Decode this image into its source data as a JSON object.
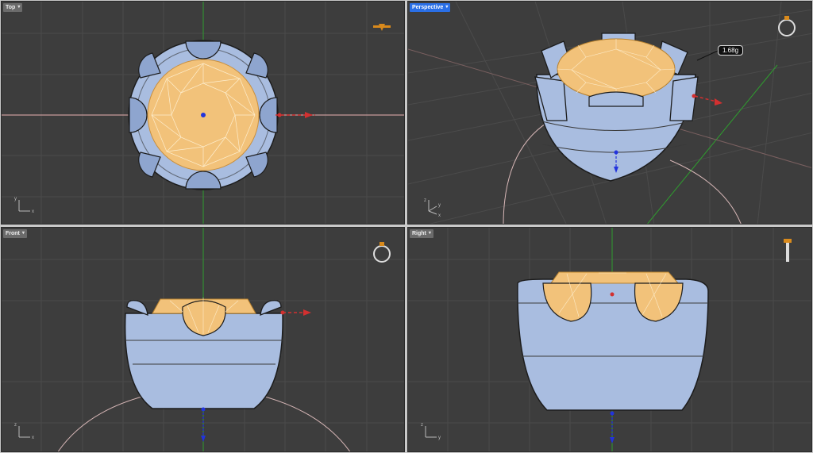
{
  "viewports": {
    "top": {
      "label": "Top"
    },
    "perspective": {
      "label": "Perspective"
    },
    "front": {
      "label": "Front"
    },
    "right": {
      "label": "Right"
    }
  },
  "dropdown_caret": "▾",
  "weight_readout": "1.68g",
  "axes": {
    "x": "x",
    "y": "y",
    "z": "z"
  },
  "colors": {
    "viewport_bg": "#3d3d3d",
    "metal": "#a9bde0",
    "gem": "#f2c27a",
    "active_tab": "#2a6fe6",
    "x_axis": "#d23030",
    "y_axis": "#2f9d2f",
    "z_axis": "#2233dd"
  },
  "icons": [
    "ring-preview-icon",
    "ring-side-icon",
    "ring-top-icon"
  ]
}
